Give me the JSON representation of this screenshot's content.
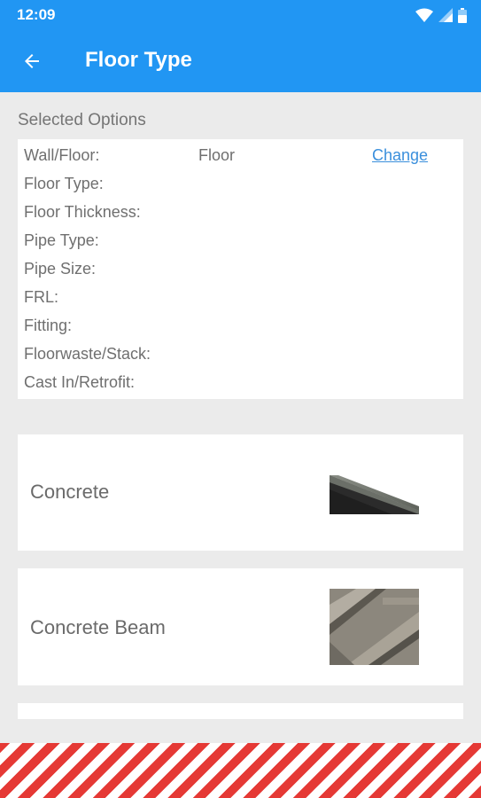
{
  "status_bar": {
    "time": "12:09",
    "icons": [
      "wifi-icon",
      "signal-icon",
      "battery-icon"
    ]
  },
  "app_bar": {
    "back_icon": "arrow-left-icon",
    "title": "Floor Type",
    "color": "#2196f3"
  },
  "selected_options": {
    "heading": "Selected Options",
    "rows": [
      {
        "label": "Wall/Floor:",
        "value": "Floor"
      },
      {
        "label": "Floor Type:",
        "value": ""
      },
      {
        "label": "Floor Thickness:",
        "value": ""
      },
      {
        "label": "Pipe Type:",
        "value": ""
      },
      {
        "label": "Pipe Size:",
        "value": ""
      },
      {
        "label": "FRL:",
        "value": ""
      },
      {
        "label": "Fitting:",
        "value": ""
      },
      {
        "label": "Floorwaste/Stack:",
        "value": ""
      },
      {
        "label": "Cast In/Retrofit:",
        "value": ""
      }
    ],
    "change_label": "Change",
    "link_color": "#3a8fdc"
  },
  "floor_types": [
    {
      "label": "Concrete",
      "thumbnail": "concrete-slab-image"
    },
    {
      "label": "Concrete Beam",
      "thumbnail": "concrete-beam-image"
    }
  ]
}
